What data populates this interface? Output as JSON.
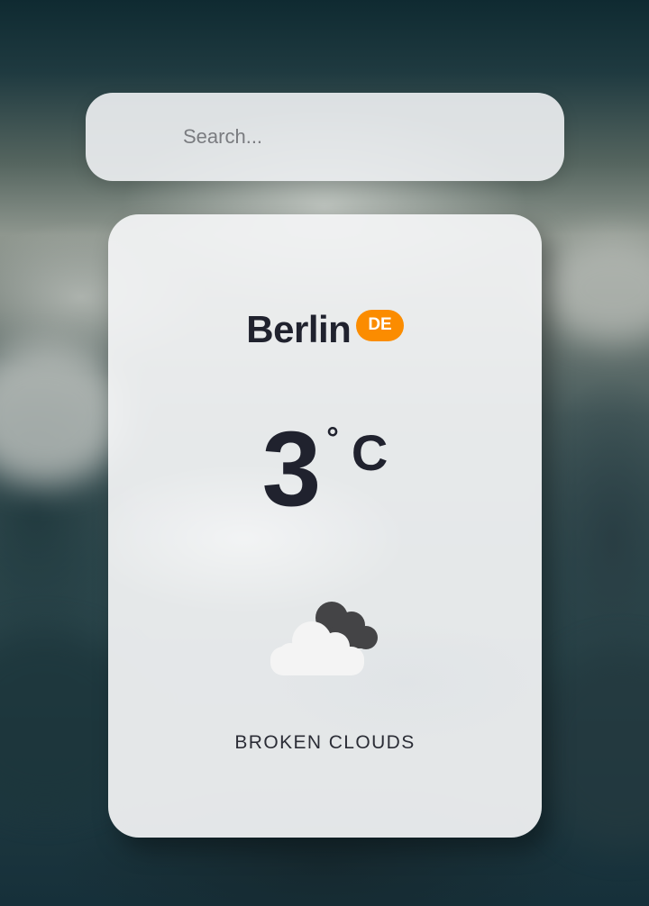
{
  "search": {
    "placeholder": "Search..."
  },
  "weather": {
    "city": "Berlin",
    "country_code": "DE",
    "temperature": "3",
    "degree_symbol": "°",
    "unit": "C",
    "condition": "BROKEN CLOUDS",
    "icon": "broken-clouds-icon"
  },
  "colors": {
    "badge_background": "#fb8c00",
    "text_primary": "#20222e",
    "card_background": "#f3f4f5"
  }
}
